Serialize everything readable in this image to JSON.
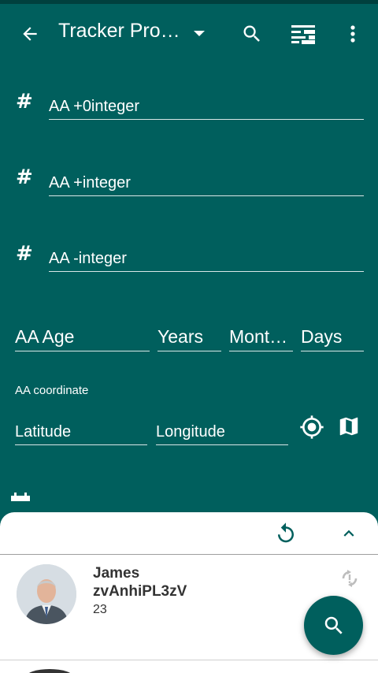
{
  "appbar": {
    "title": "Tracker Pro…",
    "back_icon": "arrow-back-icon",
    "dropdown_icon": "caret-down-icon",
    "search_icon": "search-icon",
    "filter_icon": "filter-list-icon",
    "more_icon": "more-vert-icon"
  },
  "fields": {
    "zero_integer": "AA +0integer",
    "positive_integer": "AA +integer",
    "negative_integer": "AA -integer",
    "hash_symbol": "#"
  },
  "age": {
    "label": "AA Age",
    "years": "Years",
    "months": "Mont…",
    "days": "Days"
  },
  "coordinate": {
    "label": "AA coordinate",
    "latitude": "Latitude",
    "longitude": "Longitude"
  },
  "result": {
    "name": "James",
    "uid": "zvAnhiPL3zV",
    "age": "23"
  },
  "colors": {
    "primary": "#005f5d",
    "status_bar": "#00403e",
    "sheet": "#ffffff"
  }
}
